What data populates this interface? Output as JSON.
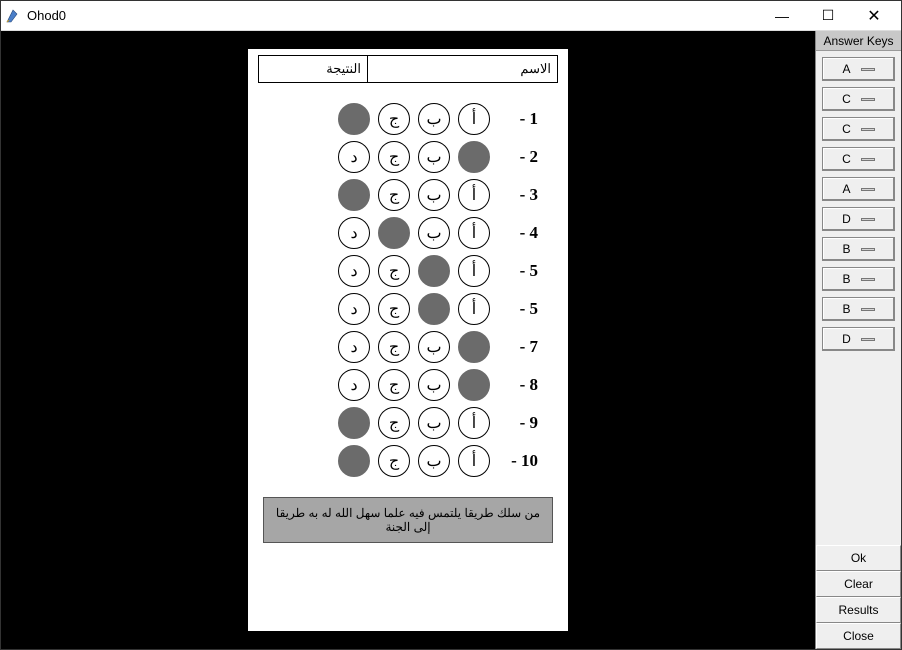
{
  "window": {
    "title": "Ohod0"
  },
  "header": {
    "score_label": "النتيجة",
    "name_label": "الاسم"
  },
  "bubbles": {
    "letters": [
      "أ",
      "ب",
      "ج",
      "د"
    ]
  },
  "rows": [
    {
      "num": "1",
      "filled": [
        3
      ]
    },
    {
      "num": "2",
      "filled": [
        0
      ]
    },
    {
      "num": "3",
      "filled": [
        3
      ]
    },
    {
      "num": "4",
      "filled": [
        2
      ]
    },
    {
      "num": "5",
      "filled": [
        1
      ]
    },
    {
      "num": "5",
      "filled": [
        1
      ]
    },
    {
      "num": "7",
      "filled": [
        0
      ]
    },
    {
      "num": "8",
      "filled": [
        0
      ]
    },
    {
      "num": "9",
      "filled": [
        3
      ]
    },
    {
      "num": "10",
      "filled": [
        3
      ]
    }
  ],
  "quote": "من سلك طريقا يلتمس فيه علما سهل الله له به طريقا إلى الجنة",
  "sidebar": {
    "title": "Answer Keys",
    "keys": [
      "A",
      "C",
      "C",
      "C",
      "A",
      "D",
      "B",
      "B",
      "B",
      "D"
    ],
    "actions": {
      "ok": "Ok",
      "clear": "Clear",
      "results": "Results",
      "close": "Close"
    }
  }
}
